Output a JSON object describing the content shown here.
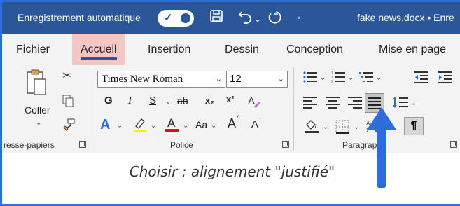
{
  "titlebar": {
    "autosave_label": "Enregistrement automatique",
    "filename": "fake news.docx • Enre"
  },
  "tabs": [
    {
      "label": "Fichier"
    },
    {
      "label": "Accueil"
    },
    {
      "label": "Insertion"
    },
    {
      "label": "Dessin"
    },
    {
      "label": "Conception"
    },
    {
      "label": "Mise en page"
    }
  ],
  "clipboard": {
    "paste_label": "Coller",
    "group_label": "resse-papiers"
  },
  "font": {
    "name": "Times New Roman",
    "size": "12",
    "bold": "G",
    "italic": "I",
    "underline": "S",
    "strike": "ab",
    "subscript": "x₂",
    "superscript": "x²",
    "case": "Aa",
    "grow": "A",
    "shrink": "A",
    "group_label": "Police"
  },
  "paragraph": {
    "group_label": "Paragraphe",
    "pilcrow": "¶"
  },
  "caption": "Choisir : alignement \"justifié\"",
  "colors": {
    "titlebar": "#2b579a",
    "active_tab_highlight": "#f5c6c6",
    "arrow": "#2f6cd8"
  }
}
